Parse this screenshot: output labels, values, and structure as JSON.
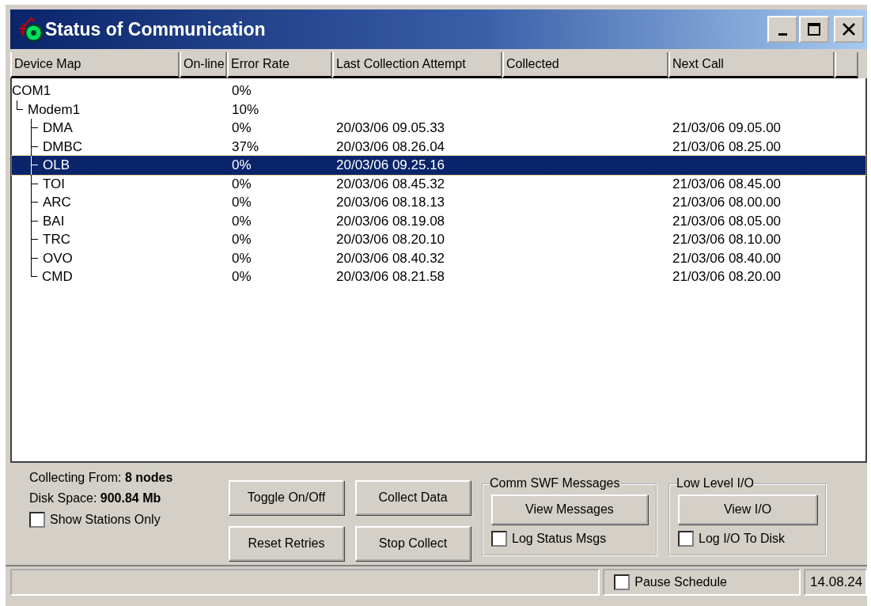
{
  "window": {
    "title": "Status of Communication"
  },
  "table": {
    "columns": [
      "Device Map",
      "On-line",
      "Error Rate",
      "Last Collection Attempt",
      "Collected",
      "Next Call"
    ],
    "rows": [
      {
        "name": "COM1",
        "error_rate": "0%",
        "selected": false,
        "children": [
          {
            "name": "Modem1",
            "error_rate": "10%",
            "selected": false,
            "children": [
              {
                "name": "DMA",
                "error_rate": "0%",
                "last_attempt": "20/03/06 09.05.33",
                "next_call": "21/03/06 09.05.00",
                "selected": false
              },
              {
                "name": "DMBC",
                "error_rate": "37%",
                "last_attempt": "20/03/06 08.26.04",
                "next_call": "21/03/06 08.25.00",
                "selected": false
              },
              {
                "name": "OLB",
                "error_rate": "0%",
                "last_attempt": "20/03/06 09.25.16",
                "selected": true
              },
              {
                "name": "TOI",
                "error_rate": "0%",
                "last_attempt": "20/03/06 08.45.32",
                "next_call": "21/03/06 08.45.00",
                "selected": false
              },
              {
                "name": "ARC",
                "error_rate": "0%",
                "last_attempt": "20/03/06 08.18.13",
                "next_call": "21/03/06 08.00.00",
                "selected": false
              },
              {
                "name": "BAI",
                "error_rate": "0%",
                "last_attempt": "20/03/06 08.19.08",
                "next_call": "21/03/06 08.05.00",
                "selected": false
              },
              {
                "name": "TRC",
                "error_rate": "0%",
                "last_attempt": "20/03/06 08.20.10",
                "next_call": "21/03/06 08.10.00",
                "selected": false
              },
              {
                "name": "OVO",
                "error_rate": "0%",
                "last_attempt": "20/03/06 08.40.32",
                "next_call": "21/03/06 08.40.00",
                "selected": false
              },
              {
                "name": "CMD",
                "error_rate": "0%",
                "last_attempt": "20/03/06 08.21.58",
                "next_call": "21/03/06 08.20.00",
                "selected": false
              }
            ]
          }
        ]
      }
    ]
  },
  "info": {
    "collecting": "Collecting From: **8 nodes**",
    "disk_space": "Disk Space: **900.84 Mb**",
    "show_stations_only": {
      "label": "Show Stations Only",
      "checked": false
    }
  },
  "buttons": [
    "Toggle On/Off",
    "Collect Data",
    "Reset Retries",
    "Stop Collect"
  ],
  "groups": [
    {
      "title": "Comm SWF Messages",
      "button": "View Messages",
      "checkbox": {
        "label": "Log Status Msgs",
        "checked": false
      }
    },
    {
      "title": "Low Level I/O",
      "button": "View I/O",
      "checkbox": {
        "label": "Log I/O To Disk",
        "checked": false
      }
    }
  ],
  "status_bar": {
    "pause_schedule": {
      "label": "Pause Schedule",
      "checked": false
    },
    "time": "14.08.24"
  }
}
